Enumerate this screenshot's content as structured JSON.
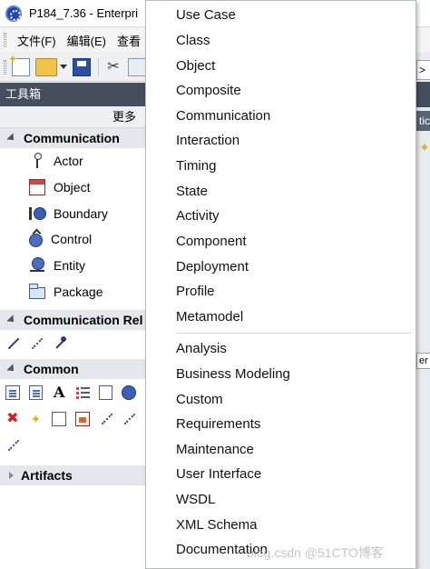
{
  "window": {
    "title": "P184_7.36 - Enterpri"
  },
  "menubar": {
    "items": [
      "文件(F)",
      "编辑(E)",
      "查看"
    ]
  },
  "right_strip": {
    "input_glyph": ">",
    "tab_text": "tic",
    "label_text": "er"
  },
  "toolbox": {
    "header": "工具箱",
    "more_label": "更多",
    "communication": {
      "header": "Communication",
      "items": [
        "Actor",
        "Object",
        "Boundary",
        "Control",
        "Entity",
        "Package"
      ]
    },
    "communication_rel": {
      "header": "Communication Rel"
    },
    "common": {
      "header": "Common"
    },
    "artifacts": {
      "header": "Artifacts"
    }
  },
  "dropdown": {
    "items": [
      "Use Case",
      "Class",
      "Object",
      "Composite",
      "Communication",
      "Interaction",
      "Timing",
      "State",
      "Activity",
      "Component",
      "Deployment",
      "Profile",
      "Metamodel"
    ],
    "items_after_separator": [
      "Analysis",
      "Business Modeling",
      "Custom",
      "Requirements",
      "Maintenance",
      "User Interface",
      "WSDL",
      "XML Schema",
      "Documentation"
    ]
  },
  "watermark": "blog.csdn @51CTO博客"
}
